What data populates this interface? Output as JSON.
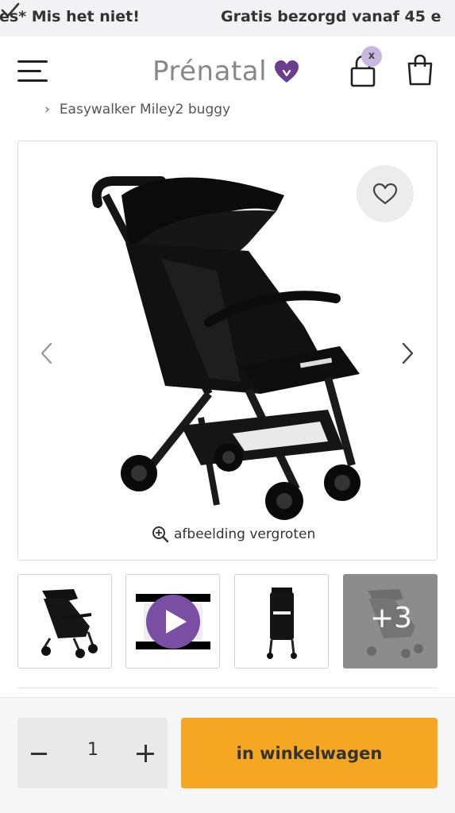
{
  "promo": {
    "left_text": "es* Mis het niet!",
    "right_text": "Gratis bezorgd vanaf 45 e"
  },
  "header": {
    "logo_text": "Prénatal",
    "account_badge": "x"
  },
  "breadcrumb": {
    "separator": "›",
    "current": "Easywalker Miley2 buggy"
  },
  "gallery": {
    "zoom_label": "afbeelding vergroten",
    "more_count": "+3"
  },
  "quantity": {
    "value": "1"
  },
  "actions": {
    "add_to_cart": "in winkelwagen"
  },
  "colors": {
    "accent_purple": "#6b3d8f",
    "cta_orange": "#f5a623",
    "promo_bg": "#f2f2f4"
  },
  "icons": [
    "check-icon",
    "menu-icon",
    "brand-heart-icon",
    "account-lock-icon",
    "shopping-bag-icon",
    "heart-outline-icon",
    "chevron-left-icon",
    "chevron-right-icon",
    "zoom-in-icon",
    "play-icon",
    "minus-icon",
    "plus-icon"
  ]
}
